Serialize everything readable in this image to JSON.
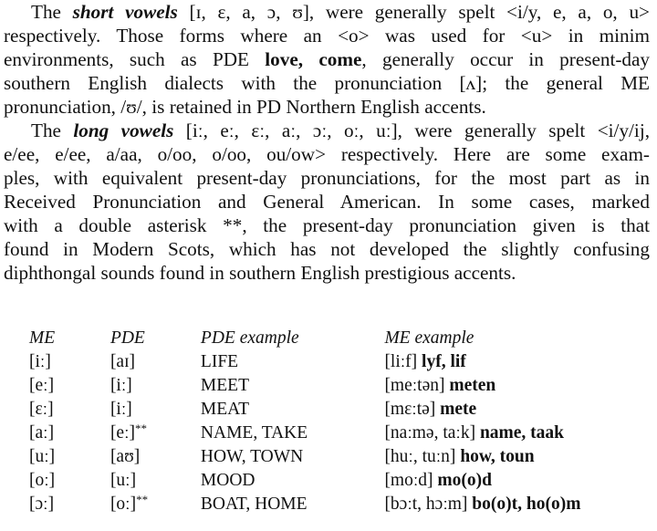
{
  "paragraph1": {
    "l1": {
      "pre": "The ",
      "term": "short vowels",
      "post": " [ɪ, ɛ, a, ɔ, ʊ], were generally spelt <i/y, e, a, o, u>"
    },
    "l2": "respectively. Those forms where an <o> was used for <u> in minim",
    "l3": {
      "pre": "environments, such as PDE ",
      "bold": "love, come",
      "post": ", generally occur in present-day"
    },
    "l4": "southern English dialects with the pronunciation [ʌ]; the general ME",
    "l5": "pronunciation, /ʊ/, is retained in PD Northern English accents."
  },
  "paragraph2": {
    "l1": {
      "pre": "The ",
      "term": "long vowels",
      "post": " [iː, eː, ɛː, aː, ɔː, oː, uː], were generally spelt <i/y/ij,"
    },
    "l2": "e/ee, e/ee, a/aa, o/oo, o/oo, ou/ow> respectively. Here are some exam-",
    "l3": "ples, with equivalent present-day pronunciations, for the most part as in",
    "l4": "Received Pronunciation and General American. In some cases, marked",
    "l5": "with a double asterisk **, the present-day pronunciation given is that",
    "l6": "found in Modern Scots, which has not developed the slightly confusing",
    "l7": "diphthongal sounds found in southern English prestigious accents."
  },
  "table": {
    "headers": [
      "ME",
      "PDE",
      "PDE example",
      "ME example"
    ],
    "rows": [
      {
        "me": "[iː]",
        "pde": "[aɪ]",
        "pde_mark": "",
        "pde_example": "LIFE",
        "me_ipa": "[liːf]",
        "me_spelling": "lyf, lif"
      },
      {
        "me": "[eː]",
        "pde": "[iː]",
        "pde_mark": "",
        "pde_example": "MEET",
        "me_ipa": "[meːtən]",
        "me_spelling": "meten"
      },
      {
        "me": "[ɛː]",
        "pde": "[iː]",
        "pde_mark": "",
        "pde_example": "MEAT",
        "me_ipa": "[mɛːtə]",
        "me_spelling": "mete"
      },
      {
        "me": "[aː]",
        "pde": "[eː]",
        "pde_mark": "**",
        "pde_example": "NAME, TAKE",
        "me_ipa": "[naːmə, taːk]",
        "me_spelling": "name, taak"
      },
      {
        "me": "[uː]",
        "pde": "[aʊ]",
        "pde_mark": "",
        "pde_example": "HOW, TOWN",
        "me_ipa": "[huː, tuːn]",
        "me_spelling": "how, toun"
      },
      {
        "me": "[oː]",
        "pde": "[uː]",
        "pde_mark": "",
        "pde_example": "MOOD",
        "me_ipa": "[moːd]",
        "me_spelling": "mo(o)d"
      },
      {
        "me": "[ɔː]",
        "pde": "[oː]",
        "pde_mark": "**",
        "pde_example": "BOAT, HOME",
        "me_ipa": "[bɔːt, hɔːm]",
        "me_spelling": "bo(o)t, ho(o)m"
      }
    ]
  }
}
